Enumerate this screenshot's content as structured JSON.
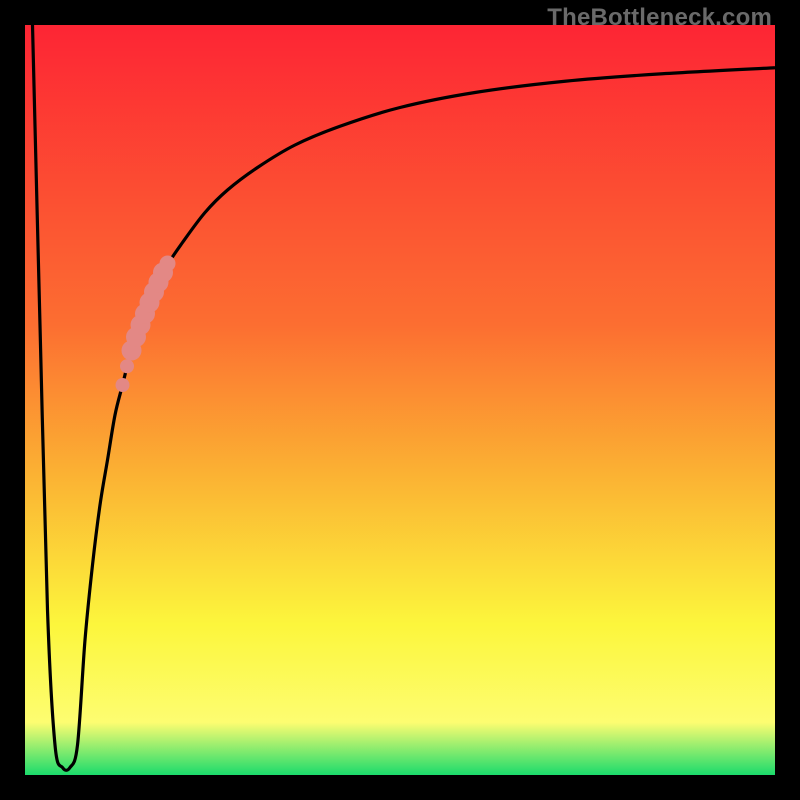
{
  "watermark": "TheBottleneck.com",
  "colors": {
    "frame": "#000000",
    "gradient_top": "#fd2534",
    "gradient_mid4": "#fc6e31",
    "gradient_mid5": "#fbb233",
    "gradient_mid6": "#fcf63c",
    "gradient_mid7": "#fdfd71",
    "gradient_bot": "#1bdb6c",
    "curve": "#000000",
    "highlight": "#e38885"
  },
  "chart_data": {
    "type": "line",
    "title": "",
    "xlabel": "",
    "ylabel": "",
    "xlim": [
      0,
      100
    ],
    "ylim": [
      0,
      100
    ],
    "series": [
      {
        "name": "bottleneck-curve",
        "x": [
          1,
          2,
          3,
          4,
          5,
          6,
          7,
          8,
          9,
          10,
          11,
          12,
          13,
          14,
          15,
          17,
          19,
          21,
          24,
          27,
          31,
          36,
          42,
          50,
          60,
          72,
          85,
          100
        ],
        "y": [
          100,
          60,
          22,
          4,
          1,
          1,
          4,
          18,
          28,
          36,
          42,
          48,
          52,
          56,
          59,
          64,
          68,
          71,
          75,
          78,
          81,
          84,
          86.5,
          89,
          91,
          92.5,
          93.5,
          94.3
        ]
      }
    ],
    "highlight_segment": {
      "series": "bottleneck-curve",
      "x_range": [
        13,
        18
      ],
      "points": [
        {
          "x": 13.0,
          "y": 52.0,
          "r": 7
        },
        {
          "x": 13.6,
          "y": 54.5,
          "r": 7
        },
        {
          "x": 14.2,
          "y": 56.6,
          "r": 10
        },
        {
          "x": 14.8,
          "y": 58.4,
          "r": 10
        },
        {
          "x": 15.4,
          "y": 60.0,
          "r": 10
        },
        {
          "x": 16.0,
          "y": 61.5,
          "r": 10
        },
        {
          "x": 16.6,
          "y": 63.0,
          "r": 10
        },
        {
          "x": 17.2,
          "y": 64.4,
          "r": 10
        },
        {
          "x": 17.8,
          "y": 65.7,
          "r": 10
        },
        {
          "x": 18.4,
          "y": 67.0,
          "r": 10
        },
        {
          "x": 19.0,
          "y": 68.2,
          "r": 8
        }
      ]
    }
  }
}
